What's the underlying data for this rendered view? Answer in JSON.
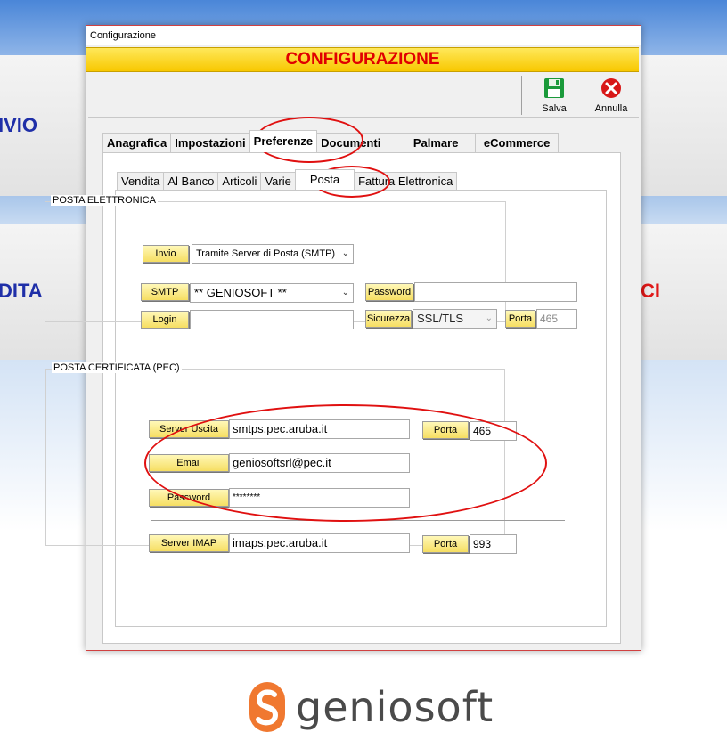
{
  "background": {
    "left_label_top": "IVIO",
    "left_label_mid": "DITA",
    "right_label_mid": "CI"
  },
  "window": {
    "title": "Configurazione",
    "banner": "CONFIGURAZIONE"
  },
  "toolbar": {
    "save_label": "Salva",
    "cancel_label": "Annulla"
  },
  "main_tabs": [
    {
      "label": "Anagrafica"
    },
    {
      "label": "Impostazioni"
    },
    {
      "label": "Preferenze",
      "active": true
    },
    {
      "label": "Documenti"
    },
    {
      "label": "Palmare"
    },
    {
      "label": "eCommerce"
    }
  ],
  "sub_tabs": [
    {
      "label": "Vendita"
    },
    {
      "label": "Al Banco"
    },
    {
      "label": "Articoli"
    },
    {
      "label": "Varie"
    },
    {
      "label": "Posta",
      "active": true
    },
    {
      "label": "Fattura Elettronica"
    }
  ],
  "email": {
    "group_title": "POSTA ELETTRONICA",
    "send_label": "Invio",
    "send_value": "Tramite Server di Posta (SMTP)",
    "smtp_label": "SMTP",
    "smtp_value": "** GENIOSOFT **",
    "password_label": "Password",
    "password_value": "",
    "login_label": "Login",
    "login_value": "",
    "security_label": "Sicurezza",
    "security_value": "SSL/TLS",
    "port_label": "Porta",
    "port_value": "465"
  },
  "pec": {
    "group_title": "POSTA CERTIFICATA (PEC)",
    "server_out_label": "Server Uscita",
    "server_out_value": "smtps.pec.aruba.it",
    "port_out_label": "Porta",
    "port_out_value": "465",
    "email_label": "Email",
    "email_value": "geniosoftsrl@pec.it",
    "password_label": "Password",
    "password_value": "********",
    "imap_label": "Server IMAP",
    "imap_value": "imaps.pec.aruba.it",
    "port_imap_label": "Porta",
    "port_imap_value": "993"
  },
  "brand": {
    "name": "geniosoft",
    "accent_color": "#f07830"
  },
  "colors": {
    "banner_text": "#e00000",
    "banner_bg": "#f8d000",
    "highlight_ring": "#e01010"
  }
}
